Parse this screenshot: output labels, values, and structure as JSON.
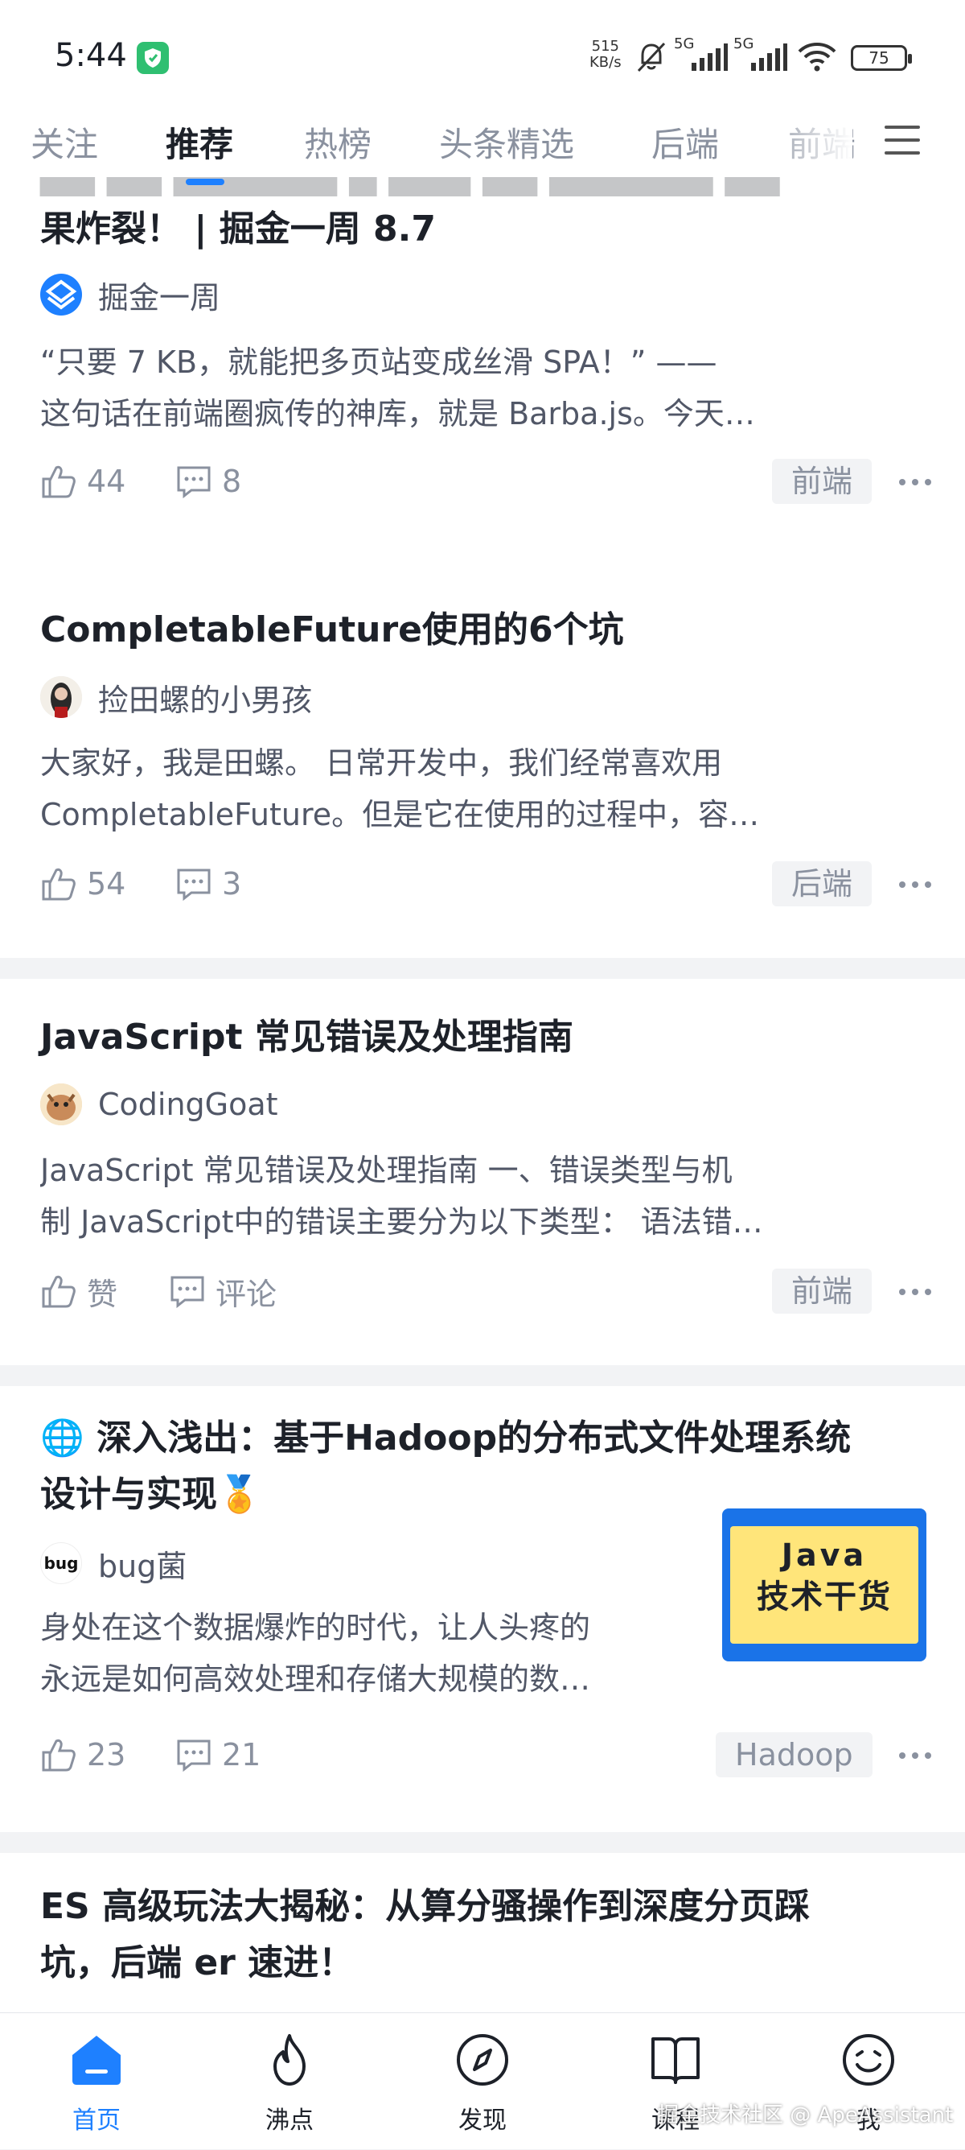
{
  "status_bar": {
    "time": "5:44",
    "net_speed_value": "515",
    "net_speed_unit": "KB/s",
    "signal_1_label": "5G",
    "signal_2_label": "5G",
    "battery": "75"
  },
  "tabs": [
    "关注",
    "推荐",
    "热榜",
    "头条精选",
    "后端",
    "前端"
  ],
  "active_tab": "推荐",
  "articles": [
    {
      "title": "果炸裂！ | 掘金一周 8.7",
      "author": "掘金一周",
      "excerpt_lines": [
        "“只要 7 KB，就能把多页站变成丝滑 SPA！” ——",
        "这句话在前端圈疯传的神库，就是 Barba.js。今天…"
      ],
      "likes": "44",
      "comments": "8",
      "tag": "前端"
    },
    {
      "title": "CompletableFuture使用的6个坑",
      "author": "捡田螺的小男孩",
      "excerpt_lines": [
        "大家好，我是田螺。 日常开发中，我们经常喜欢用",
        "CompletableFuture。但是它在使用的过程中，容…"
      ],
      "likes": "54",
      "comments": "3",
      "tag": "后端"
    },
    {
      "title": "JavaScript 常见错误及处理指南",
      "author": "CodingGoat",
      "excerpt_lines": [
        "JavaScript 常见错误及处理指南 一、错误类型与机",
        "制 JavaScript中的错误主要分为以下类型： 语法错…"
      ],
      "likes": "赞",
      "comments": "评论",
      "tag": "前端"
    },
    {
      "title_lines": [
        "🌐 深入浅出：基于Hadoop的分布式文件处理系统",
        "设计与实现🏅"
      ],
      "author": "bug菌",
      "author_avatar_text": "bug",
      "excerpt_lines": [
        "身处在这个数据爆炸的时代，让人头疼的",
        "永远是如何高效处理和存储大规模的数…"
      ],
      "thumbnail_lines": [
        "Java",
        "技术干货"
      ],
      "likes": "23",
      "comments": "21",
      "tag": "Hadoop"
    },
    {
      "title_lines": [
        "ES 高级玩法大揭秘：从算分骚操作到深度分页踩",
        "坑，后端 er 速进！"
      ]
    }
  ],
  "bottom_nav": [
    "首页",
    "沸点",
    "发现",
    "课程",
    "我"
  ],
  "active_nav": "首页",
  "watermark": "掘金技术社区 @ ApeAssistant",
  "colors": {
    "accent": "#1e80ff",
    "text_primary": "#1d2129",
    "text_secondary": "#515767",
    "text_muted": "#8a919f",
    "background": "#f2f3f5"
  }
}
